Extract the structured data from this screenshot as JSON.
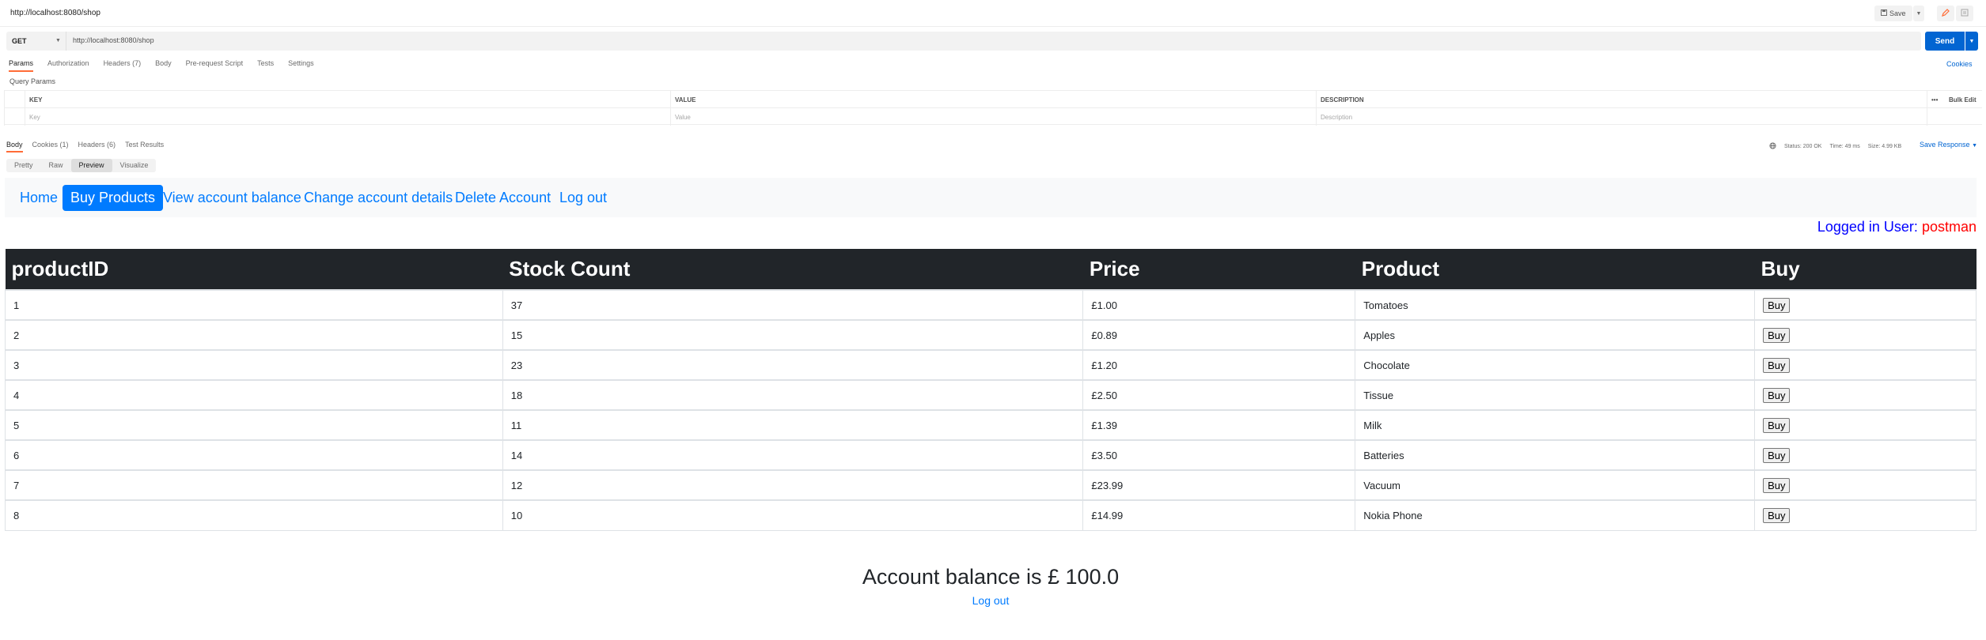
{
  "request": {
    "title": "http://localhost:8080/shop",
    "save_label": "Save",
    "method": "GET",
    "url": "http://localhost:8080/shop",
    "send_label": "Send",
    "tabs": [
      "Params",
      "Authorization",
      "Headers (7)",
      "Body",
      "Pre-request Script",
      "Tests",
      "Settings"
    ],
    "cookies_label": "Cookies",
    "query_params_label": "Query Params",
    "params_headers": [
      "KEY",
      "VALUE",
      "DESCRIPTION"
    ],
    "params_placeholders": [
      "Key",
      "Value",
      "Description"
    ],
    "bulk_edit_label": "Bulk Edit",
    "more_label": "•••"
  },
  "response": {
    "tabs": [
      "Body",
      "Cookies (1)",
      "Headers (6)",
      "Test Results"
    ],
    "status": "Status: 200 OK",
    "time": "Time: 49 ms",
    "size": "Size: 4.99 KB",
    "save_response_label": "Save Response",
    "view_tabs": [
      "Pretty",
      "Raw",
      "Preview",
      "Visualize"
    ]
  },
  "page": {
    "nav": [
      "Home",
      "Buy Products",
      "View account balance",
      "Change account details",
      "Delete Account",
      "Log out"
    ],
    "logged_in_prefix": "Logged in User:",
    "logged_in_user": "postman",
    "table_headers": [
      "productID",
      "Stock Count",
      "Price",
      "Product",
      "Buy"
    ],
    "products": [
      {
        "id": "1",
        "stock": "37",
        "price": "£1.00",
        "name": "Tomatoes",
        "buy": "Buy"
      },
      {
        "id": "2",
        "stock": "15",
        "price": "£0.89",
        "name": "Apples",
        "buy": "Buy"
      },
      {
        "id": "3",
        "stock": "23",
        "price": "£1.20",
        "name": "Chocolate",
        "buy": "Buy"
      },
      {
        "id": "4",
        "stock": "18",
        "price": "£2.50",
        "name": "Tissue",
        "buy": "Buy"
      },
      {
        "id": "5",
        "stock": "11",
        "price": "£1.39",
        "name": "Milk",
        "buy": "Buy"
      },
      {
        "id": "6",
        "stock": "14",
        "price": "£3.50",
        "name": "Batteries",
        "buy": "Buy"
      },
      {
        "id": "7",
        "stock": "12",
        "price": "£23.99",
        "name": "Vacuum",
        "buy": "Buy"
      },
      {
        "id": "8",
        "stock": "10",
        "price": "£14.99",
        "name": "Nokia Phone",
        "buy": "Buy"
      }
    ],
    "balance_text": "Account balance is £ 100.0",
    "bottom_logout": "Log out"
  },
  "colors": {
    "accent": "#0265d2",
    "tab_underline": "#ff6c37",
    "page_link": "#007bff",
    "table_header_bg": "#212529",
    "user_label": "#0000ff",
    "user_name": "#ff0000"
  }
}
